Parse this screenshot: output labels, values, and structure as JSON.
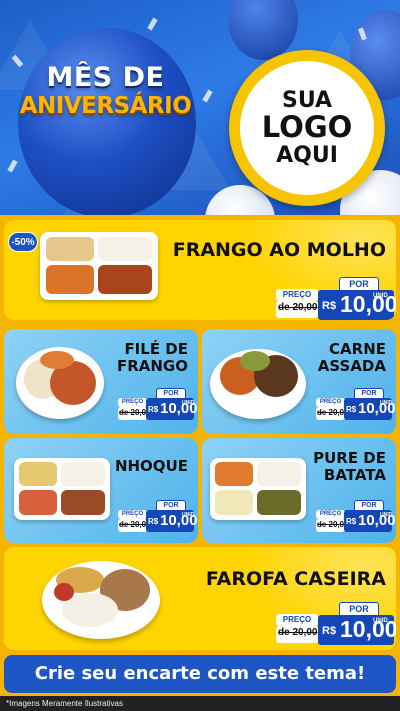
{
  "header": {
    "title_line1": "MÊS DE",
    "title_line2": "ANIVERSÁRIO",
    "logo_line1": "SUA",
    "logo_line2": "LOGO",
    "logo_line3": "AQUI"
  },
  "badge": "-50%",
  "price_labels": {
    "por": "POR",
    "preco": "PREÇO",
    "old": "de 20,00",
    "rs": "R$",
    "value": "10,00",
    "unid": "UNID"
  },
  "products": [
    {
      "name_l1": "FRANGO AO MOLHO",
      "name_l2": ""
    },
    {
      "name_l1": "FILÉ DE",
      "name_l2": "FRANGO"
    },
    {
      "name_l1": "CARNE",
      "name_l2": "ASSADA"
    },
    {
      "name_l1": "NHOQUE",
      "name_l2": ""
    },
    {
      "name_l1": "PURE DE",
      "name_l2": "BATATA"
    },
    {
      "name_l1": "FAROFA CASEIRA",
      "name_l2": ""
    }
  ],
  "cta": "Crie seu encarte com este tema!",
  "footer": "*Imagens Meramente Ilustrativas",
  "colors": {
    "accent_blue": "#1447b8",
    "yellow": "#ffd400",
    "light_blue": "#4fb3ea"
  }
}
